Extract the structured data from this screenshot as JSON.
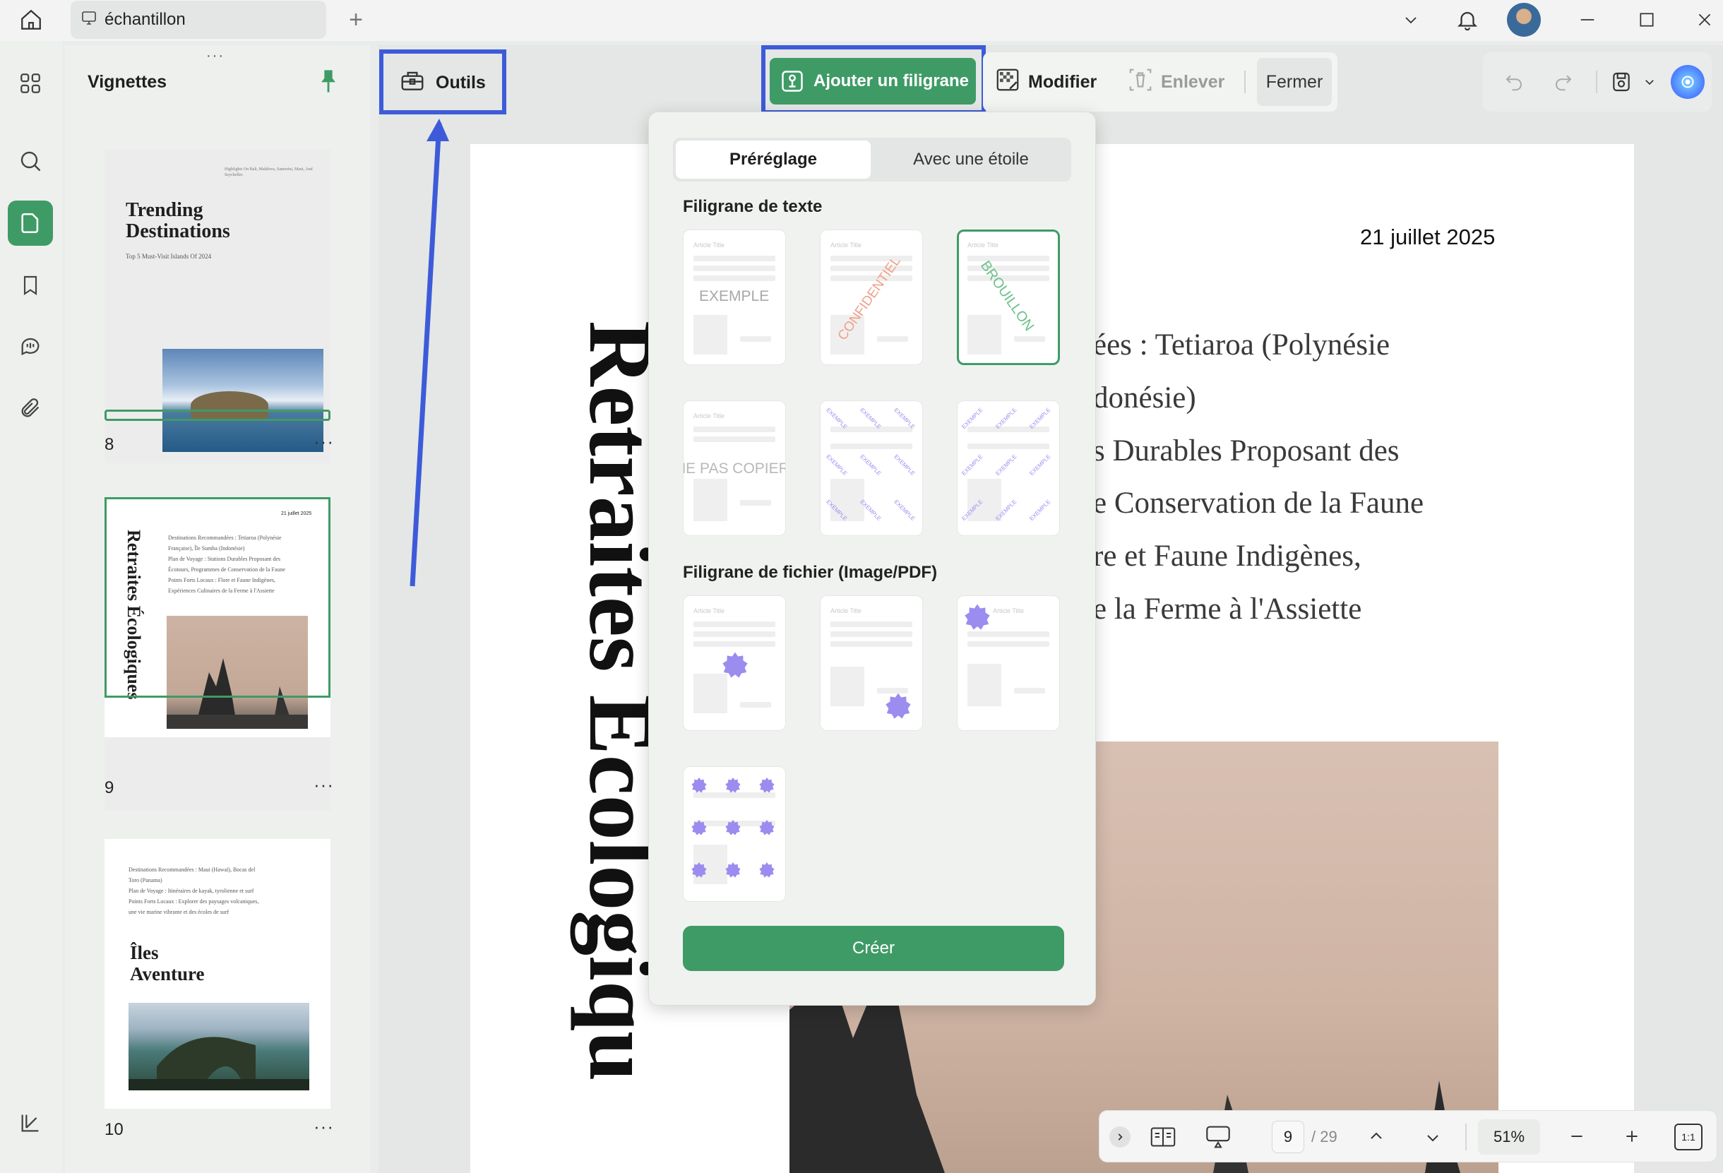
{
  "titlebar": {
    "tab_title": "échantillon"
  },
  "thumbnails": {
    "title": "Vignettes",
    "pages": [
      {
        "number": "8",
        "heading_line1": "Trending",
        "heading_line2": "Destinations",
        "subtitle": "Top 5 Must-Visit Islands Of 2024",
        "small_text": "Highlights On Bali, Maldives, Santorini, Maui, And Seychelles"
      },
      {
        "number": "9",
        "date": "21 juillet 2025",
        "vertical_title": "Retraites Écologiques",
        "lines": [
          "Destinations Recommandées : Tetiaroa (Polynésie",
          "Française), Île Sumba (Indonésie)",
          "Plan de Voyage : Stations Durables Proposant des",
          "Écotours, Programmes de Conservation de la Faune",
          "Points Forts Locaux : Flore et Faune Indigènes,",
          "Expériences Culinaires de la Ferme à l'Assiette"
        ]
      },
      {
        "number": "10",
        "heading_line1": "Îles",
        "heading_line2": "Aventure",
        "lines": [
          "Destinations Recommandées : Maui (Hawaï), Bocas del",
          "Toro (Panama)",
          "Plan de Voyage : Itinéraires de kayak, tyrolienne et surf",
          "Points Forts Locaux : Explorer des paysages volcaniques,",
          "une vie marine vibrante et des écoles de surf"
        ]
      }
    ]
  },
  "toolbar": {
    "outils": "Outils",
    "add_watermark": "Ajouter un filigrane",
    "modify": "Modifier",
    "remove": "Enlever",
    "close": "Fermer"
  },
  "document": {
    "date": "21 juillet 2025",
    "vertical_title": "Retraites Écologiqu",
    "lines": [
      "ées : Tetiaroa (Polynésie",
      "donésie)",
      "s Durables Proposant des",
      "e Conservation de la Faune",
      "re et Faune Indigènes,",
      "e la Ferme à l'Assiette"
    ]
  },
  "popup": {
    "tabs": [
      "Préréglage",
      "Avec une étoile"
    ],
    "text_section": "Filigrane de texte",
    "file_section": "Filigrane de fichier (Image/PDF)",
    "placeholder": "Article Title",
    "text_presets": [
      {
        "text": "EXEMPLE",
        "color": "#a8a8a8"
      },
      {
        "text": "CONFIDENTIEL",
        "color": "#f0a08a"
      },
      {
        "text": "BROUILLON",
        "color": "#6cc08a"
      },
      {
        "text": "NE PAS COPIER",
        "color": "#b8b8b8"
      },
      {
        "text": "EXEMPLE",
        "color": "#9b8cf0"
      },
      {
        "text": "EXEMPLE",
        "color": "#9b8cf0"
      }
    ],
    "create_label": "Créer"
  },
  "bottombar": {
    "current_page": "9",
    "total_pages": "/ 29",
    "zoom": "51%",
    "fit_label": "1:1"
  },
  "colors": {
    "accent": "#3f9b66",
    "highlight": "#3d5bd9",
    "star": "#9b8cf0"
  }
}
